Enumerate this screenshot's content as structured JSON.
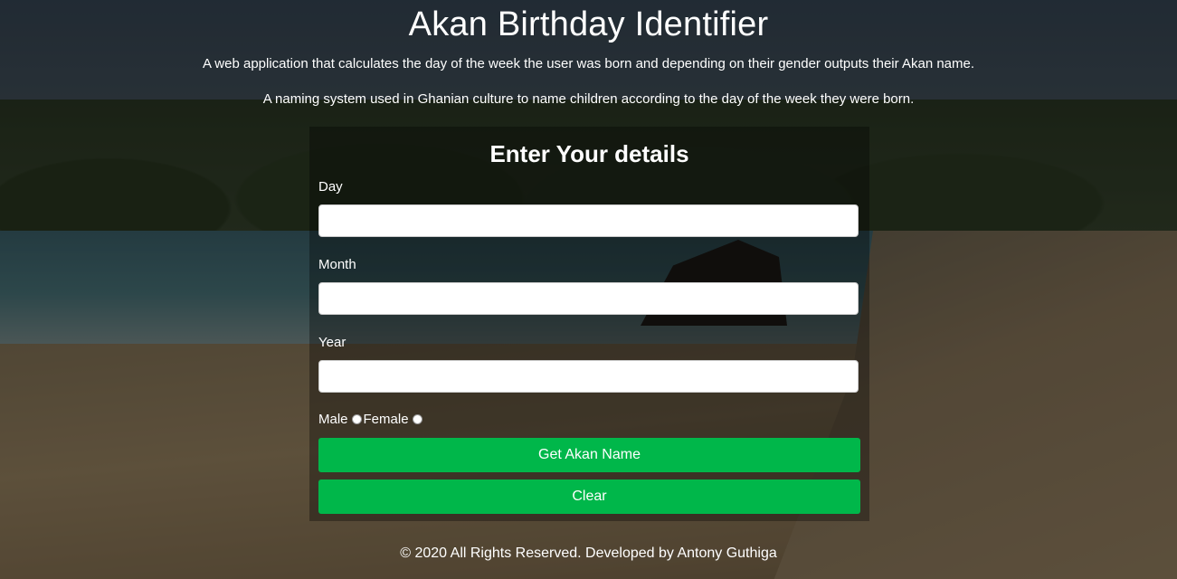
{
  "header": {
    "title": "Akan Birthday Identifier",
    "description_1": "A web application that calculates the day of the week the user was born and depending on their gender outputs their Akan name.",
    "description_2": "A naming system used in Ghanian culture to name children according to the day of the week they were born."
  },
  "form": {
    "title": "Enter Your details",
    "day": {
      "label": "Day",
      "value": "",
      "placeholder": ""
    },
    "month": {
      "label": "Month",
      "value": "",
      "placeholder": ""
    },
    "year": {
      "label": "Year",
      "value": "",
      "placeholder": ""
    },
    "gender": {
      "male_label": "Male",
      "female_label": "Female"
    },
    "submit_label": "Get Akan Name",
    "clear_label": "Clear"
  },
  "footer": {
    "text": "© 2020 All Rights Reserved. Developed by Antony Guthiga"
  },
  "colors": {
    "button": "#00b74a",
    "text": "#ffffff"
  }
}
